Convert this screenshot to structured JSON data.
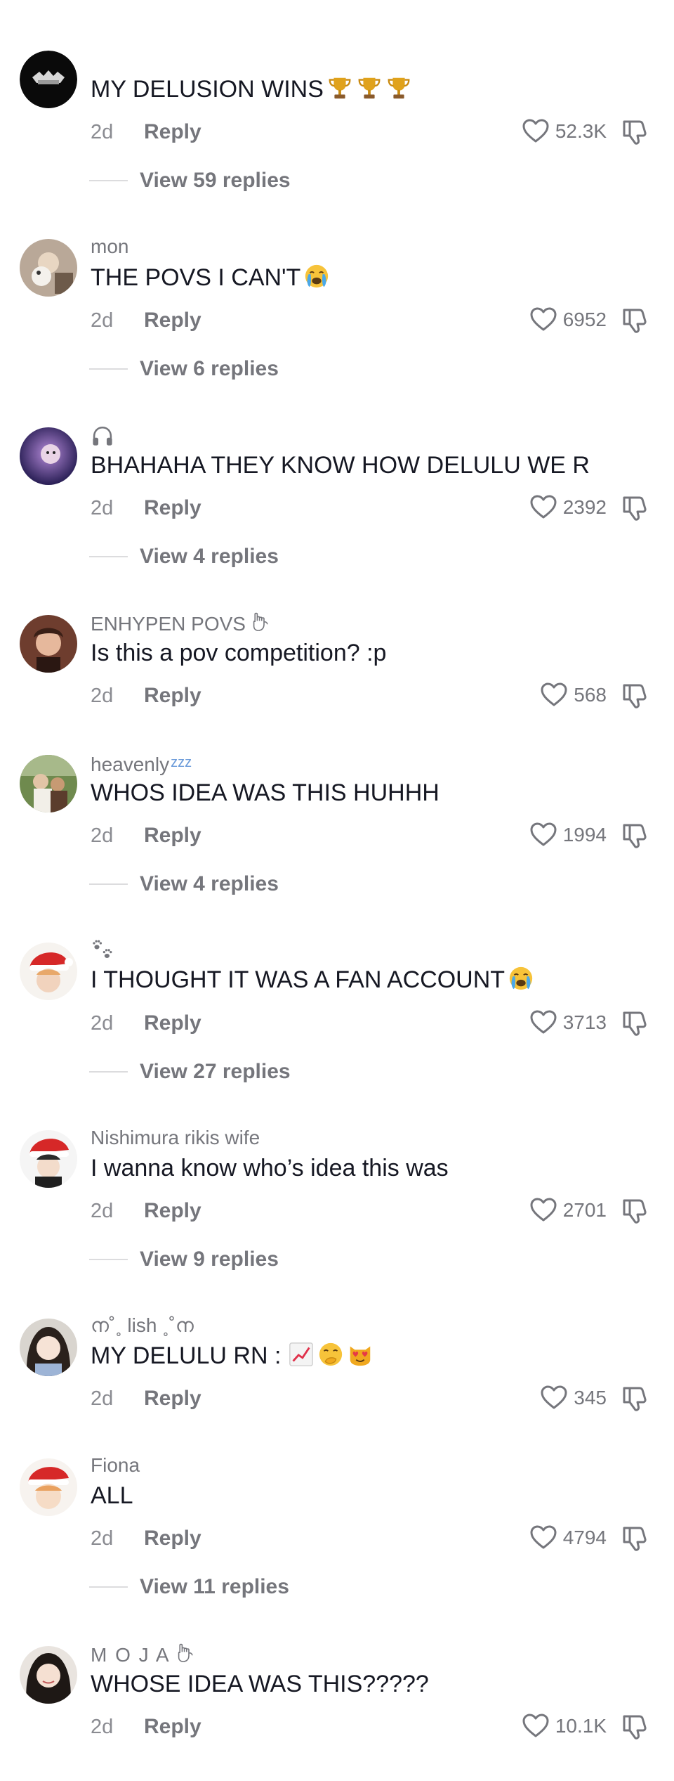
{
  "colors": {
    "text_primary": "#161823",
    "text_secondary": "#75767c",
    "divider": "#dcdcde"
  },
  "comments": [
    {
      "username": "",
      "text": "MY DELUSION WINS",
      "emojis": [
        "trophy",
        "trophy",
        "trophy"
      ],
      "time": "2d",
      "reply_label": "Reply",
      "likes": "52.3K",
      "view_replies": "View 59 replies"
    },
    {
      "username": "mon",
      "text": "THE POVS I CAN'T",
      "emojis": [
        "loudly-crying-face"
      ],
      "time": "2d",
      "reply_label": "Reply",
      "likes": "6952",
      "view_replies": "View 6 replies"
    },
    {
      "username": "",
      "username_icon": "headphones-icon",
      "text": "BHAHAHA THEY KNOW HOW DELULU WE R",
      "time": "2d",
      "reply_label": "Reply",
      "likes": "2392",
      "view_replies": "View 4 replies"
    },
    {
      "username": "ENHYPEN POVS",
      "username_icon": "pinky-promise-icon",
      "text": "Is this a pov competition? :p",
      "time": "2d",
      "reply_label": "Reply",
      "likes": "568"
    },
    {
      "username": "heavenly",
      "username_suffix": "zzz",
      "text": "WHOS IDEA WAS THIS HUHHH",
      "time": "2d",
      "reply_label": "Reply",
      "likes": "1994",
      "view_replies": "View 4 replies"
    },
    {
      "username": "",
      "username_icon": "paw-prints-icon",
      "text": "I THOUGHT IT WAS A FAN ACCOUNT",
      "emojis": [
        "loudly-crying-face"
      ],
      "time": "2d",
      "reply_label": "Reply",
      "likes": "3713",
      "view_replies": "View 27 replies"
    },
    {
      "username": "Nishimura rikis wife",
      "text": "I wanna know who’s idea this was",
      "time": "2d",
      "reply_label": "Reply",
      "likes": "2701",
      "view_replies": "View 9 replies"
    },
    {
      "username": "ന˚˳ lish ˳˚ന",
      "text": "MY DELULU RN :",
      "emojis": [
        "chart-increasing",
        "face-with-hand-over-mouth",
        "smiling-cat-heart-eyes"
      ],
      "time": "2d",
      "reply_label": "Reply",
      "likes": "345"
    },
    {
      "username": "Fiona",
      "text": "ALL",
      "time": "2d",
      "reply_label": "Reply",
      "likes": "4794",
      "view_replies": "View 11 replies"
    },
    {
      "username": "M O J A",
      "username_icon": "pinky-promise-icon",
      "text": "WHOSE IDEA WAS THIS?????",
      "time": "2d",
      "reply_label": "Reply",
      "likes": "10.1K"
    }
  ]
}
